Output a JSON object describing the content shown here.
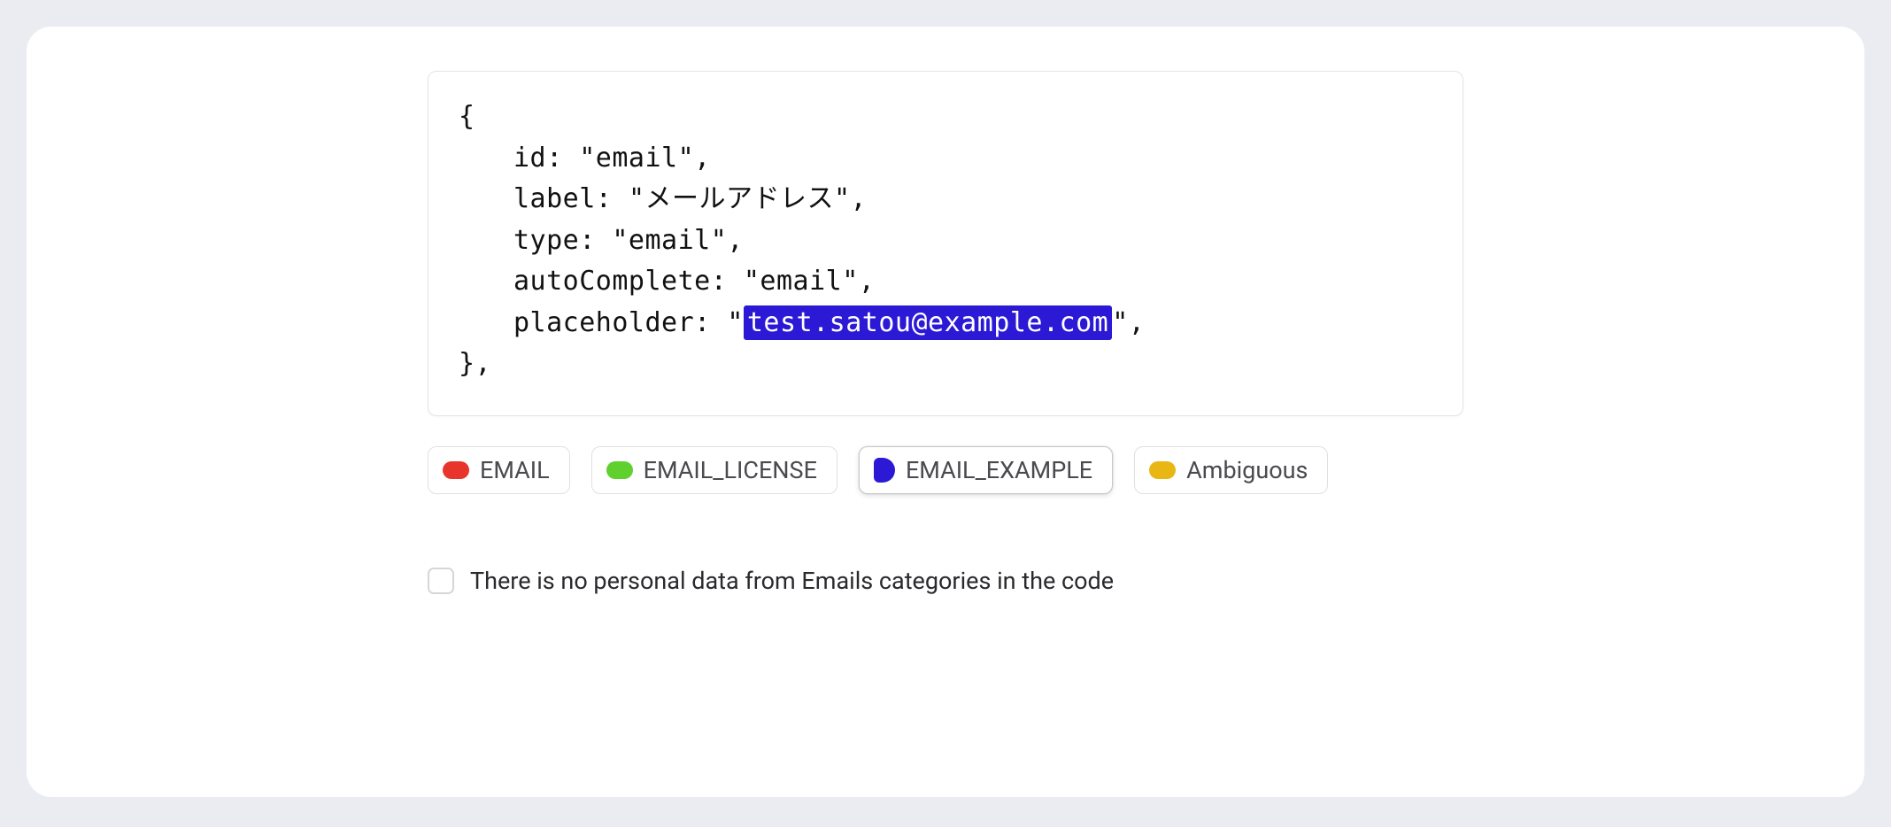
{
  "code": {
    "open_brace": "{",
    "line1_key": "id: ",
    "line1_val": "\"email\",",
    "line2_key": "label: ",
    "line2_val": "\"メールアドレス\",",
    "line3_key": "type: ",
    "line3_val": "\"email\",",
    "line4_key": "autoComplete: ",
    "line4_val": "\"email\",",
    "line5_key": "placeholder: ",
    "line5_quote_open": "\"",
    "line5_highlighted": "test.satou@example.com",
    "line5_quote_close": "\",",
    "close_brace": "},"
  },
  "tags": {
    "email": "EMAIL",
    "email_license": "EMAIL_LICENSE",
    "email_example": "EMAIL_EXAMPLE",
    "ambiguous": "Ambiguous"
  },
  "checkbox": {
    "label": "There is no personal data from Emails categories in the code"
  },
  "colors": {
    "highlight_bg": "#2b19d6",
    "tag_red": "#e7352c",
    "tag_green": "#5fd02e",
    "tag_blue": "#2b19d6",
    "tag_yellow": "#e8b714"
  }
}
